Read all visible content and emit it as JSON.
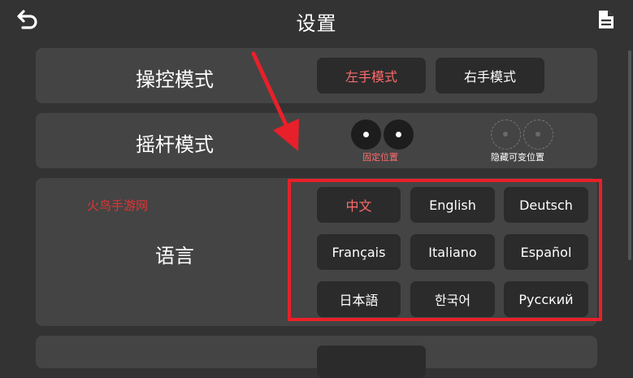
{
  "header": {
    "title": "设置",
    "back_icon": "back-arrow-icon",
    "doc_icon": "document-icon"
  },
  "control_mode": {
    "label": "操控模式",
    "options": [
      "左手模式",
      "右手模式"
    ],
    "selected": "左手模式"
  },
  "joystick_mode": {
    "label": "摇杆模式",
    "fixed_caption": "固定位置",
    "hidden_caption": "隐藏可变位置",
    "selected": "固定位置"
  },
  "language": {
    "label": "语言",
    "options": [
      "中文",
      "English",
      "Deutsch",
      "Français",
      "Italiano",
      "Español",
      "日本語",
      "한국어",
      "Русский"
    ],
    "selected": "中文"
  },
  "watermark": "火鸟手游网",
  "colors": {
    "background": "#333333",
    "panel": "#444444",
    "button": "#2b2b2b",
    "active_text": "#ff6b6b",
    "highlight_red": "#e8202a"
  }
}
